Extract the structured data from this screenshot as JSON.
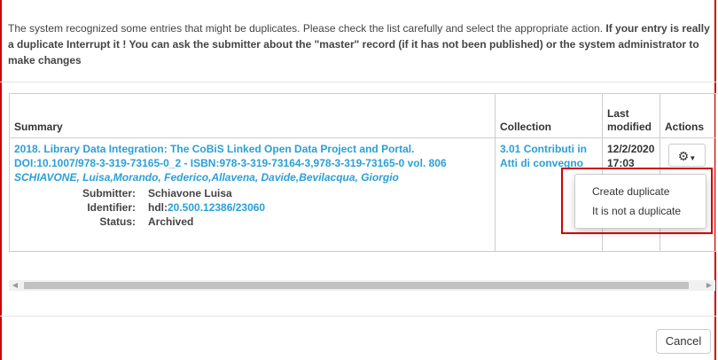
{
  "notice": {
    "text_normal": "The system recognized some entries that might be duplicates. Please check the list carefully and select the appropriate action.",
    "text_bold": "If your entry is really a duplicate Interrupt it ! You can ask the submitter about the \"master\" record (if it has not been published) or the system administrator to make changes"
  },
  "table": {
    "headers": {
      "summary": "Summary",
      "collection": "Collection",
      "last_modified": "Last modified",
      "actions": "Actions"
    },
    "row": {
      "title_line": "2018. Library Data Integration: The CoBiS Linked Open Data Project and Portal.",
      "doi_line": "DOI:10.1007/978-3-319-73165-0_2 - ISBN:978-3-319-73164-3,978-3-319-73165-0 vol. 806",
      "authors": "SCHIAVONE, Luisa,Morando, Federico,Allavena, Davide,Bevilacqua, Giorgio",
      "submitter_label": "Submitter:",
      "submitter_value": "Schiavone Luisa",
      "identifier_label": "Identifier:",
      "identifier_prefix": "hdl:",
      "identifier_link": "20.500.12386/23060",
      "status_label": "Status:",
      "status_value": "Archived",
      "collection": "3.01 Contributi in Atti di convegno",
      "last_modified": "12/2/2020 17:03"
    }
  },
  "actions_menu": {
    "items": [
      "Create duplicate",
      "It is not a duplicate"
    ]
  },
  "footer": {
    "cancel_label": "Cancel"
  },
  "colors": {
    "link": "#2a9fd6",
    "highlight": "#cc0000"
  }
}
